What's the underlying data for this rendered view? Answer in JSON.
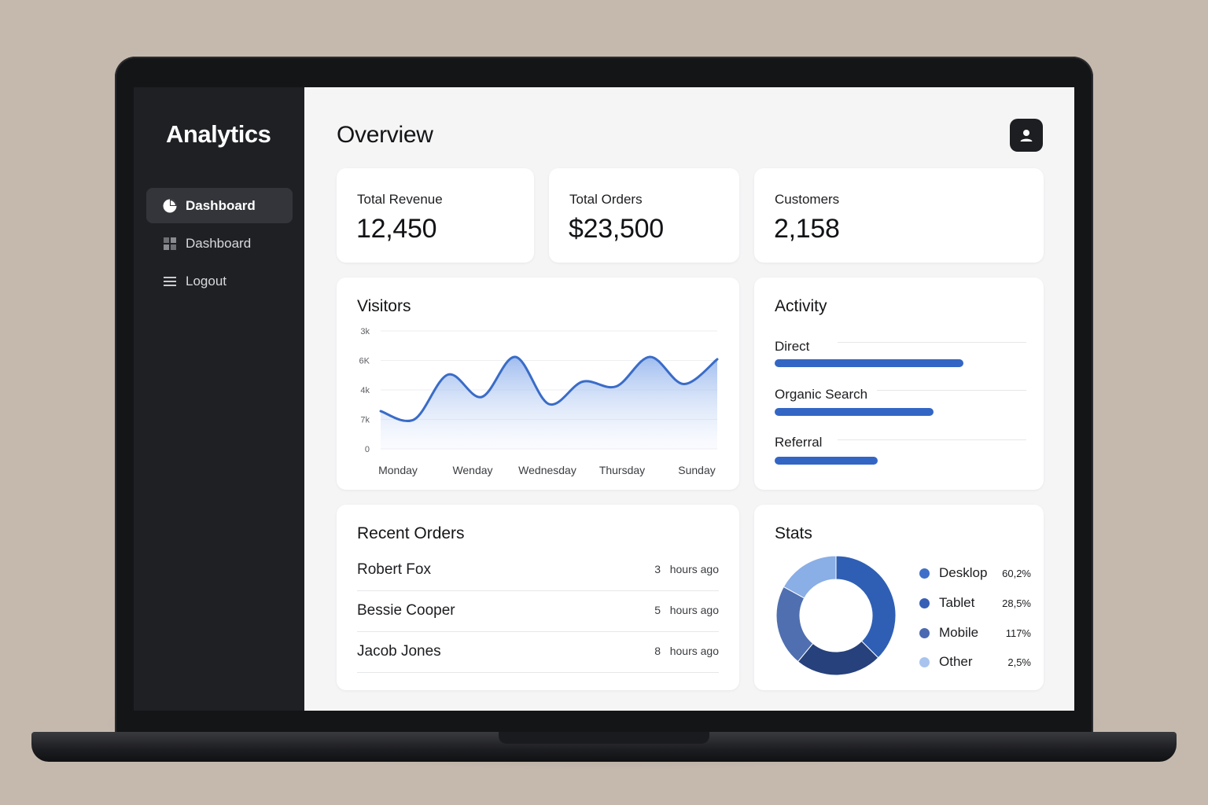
{
  "app": {
    "brand": "Analytics"
  },
  "sidebar": {
    "items": [
      {
        "label": "Dashboard",
        "icon": "pie-chart-icon",
        "active": true
      },
      {
        "label": "Dashboard",
        "icon": "grid-icon",
        "active": false
      },
      {
        "label": "Logout",
        "icon": "menu-lines-icon",
        "active": false
      }
    ]
  },
  "header": {
    "title": "Overview",
    "avatar_icon": "user-icon"
  },
  "stats": [
    {
      "label": "Total Revenue",
      "value": "12,450"
    },
    {
      "label": "Total Orders",
      "value": "$23,500"
    },
    {
      "label": "Customers",
      "value": "2,158"
    }
  ],
  "visitors": {
    "title": "Visitors",
    "chart_data": {
      "type": "area",
      "title": "Visitors",
      "y_tick_labels": [
        "3k",
        "6K",
        "4k",
        "7k",
        "0"
      ],
      "x_tick_labels": [
        "Monday",
        "Wenday",
        "Wednesday",
        "Thursday",
        "Sunday"
      ],
      "x": [
        0,
        0.5,
        1,
        1.5,
        2,
        2.5,
        3,
        3.5,
        4,
        4.5,
        5
      ],
      "values": [
        0.32,
        0.25,
        0.63,
        0.44,
        0.78,
        0.38,
        0.57,
        0.53,
        0.78,
        0.55,
        0.76
      ],
      "color": "#3a6cc8",
      "grid": true
    }
  },
  "activity": {
    "title": "Activity",
    "items": [
      {
        "label": "Direct",
        "value": 0.75
      },
      {
        "label": "Organic Search",
        "value": 0.63
      },
      {
        "label": "Referral",
        "value": 0.41
      }
    ],
    "bar_color": "#3366c4"
  },
  "orders": {
    "title": "Recent Orders",
    "rows": [
      {
        "name": "Robert Fox",
        "count": "3",
        "unit": "hours ago"
      },
      {
        "name": "Bessie Cooper",
        "count": "5",
        "unit": "hours ago"
      },
      {
        "name": "Jacob Jones",
        "count": "8",
        "unit": "hours ago"
      }
    ]
  },
  "stats_panel": {
    "title": "Stats",
    "chart_data": {
      "type": "pie",
      "categories": [
        "Desklop",
        "Tablet",
        "Mobile",
        "Other"
      ],
      "value_labels": [
        "60,2%",
        "28,5%",
        "117%",
        "2,5%"
      ],
      "values": [
        0.375,
        0.235,
        0.22,
        0.17
      ],
      "colors": [
        "#2f5fb5",
        "#26417c",
        "#4f6fb0",
        "#8aaee6"
      ],
      "legend_colors": [
        "#3f70c9",
        "#3660b6",
        "#4a69b3",
        "#a8c4ee"
      ]
    }
  }
}
